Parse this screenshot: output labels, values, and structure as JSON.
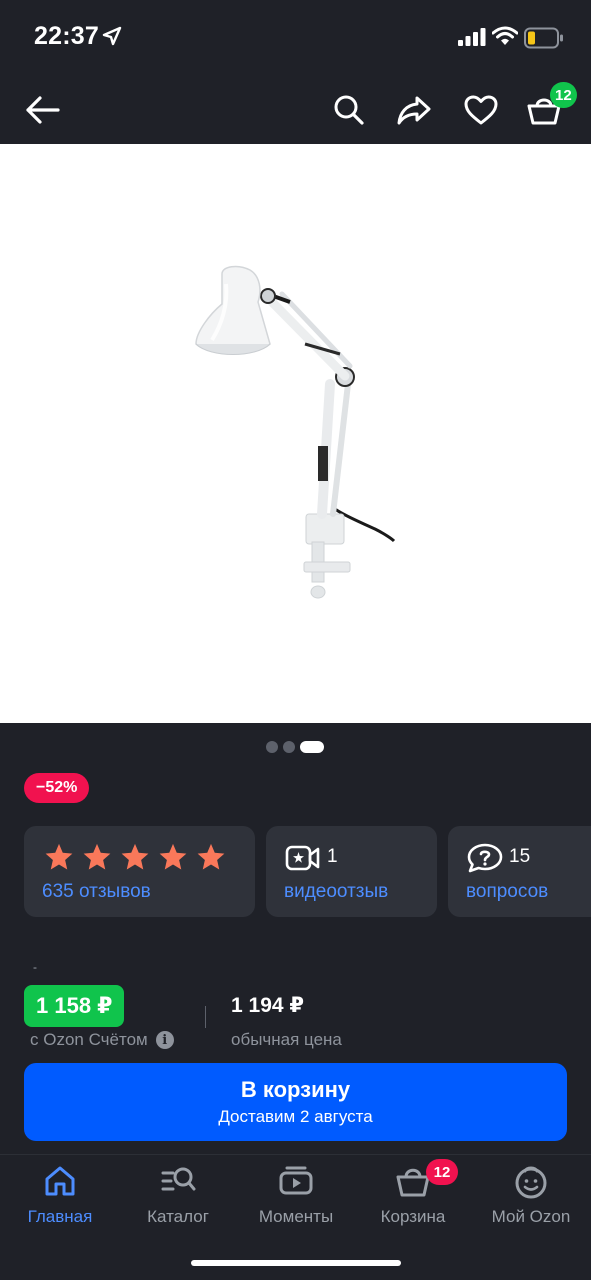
{
  "status_bar": {
    "time": "22:37",
    "icons": [
      "location-arrow-icon",
      "signal-icon",
      "wifi-icon",
      "battery-icon"
    ]
  },
  "nav": {
    "icons": [
      "back-arrow-icon",
      "search-icon",
      "share-icon",
      "heart-icon",
      "cart-icon"
    ],
    "cart_badge": "12",
    "cart_badge_color": "#10c44c"
  },
  "gallery": {
    "image": "desk-lamp-photo",
    "dots_total": 3,
    "active_dot": 3
  },
  "product": {
    "discount": "−52%",
    "rating_stars": 5,
    "rating_value_of_5": 5,
    "reviews_label": "635 отзывов",
    "video_count": "1",
    "video_label": "видеоотзыв",
    "questions_count": "15",
    "questions_label": "вопросов",
    "tiny_mark": "-",
    "price_ozon": "1 158 ₽",
    "price_ozon_caption": "с Ozon Счётом",
    "price_regular": "1 194 ₽",
    "price_regular_caption": "обычная цена"
  },
  "cart_button": {
    "title": "В корзину",
    "subtitle": "Доставим 2 августа"
  },
  "tab_bar": {
    "tabs": [
      {
        "label": "Главная",
        "icon": "home-icon",
        "active": true
      },
      {
        "label": "Каталог",
        "icon": "catalog-icon",
        "active": false
      },
      {
        "label": "Моменты",
        "icon": "moments-icon",
        "active": false
      },
      {
        "label": "Корзина",
        "icon": "cart-icon",
        "active": false,
        "badge": "12"
      },
      {
        "label": "Мой Ozon",
        "icon": "profile-icon",
        "active": false
      }
    ]
  },
  "colors": {
    "background": "#1f2128",
    "card": "#2f323a",
    "accent_blue": "#005bff",
    "link_blue": "#4d8dff",
    "green": "#10c44c",
    "discount_red": "#f1124f",
    "star": "#f9785a"
  }
}
